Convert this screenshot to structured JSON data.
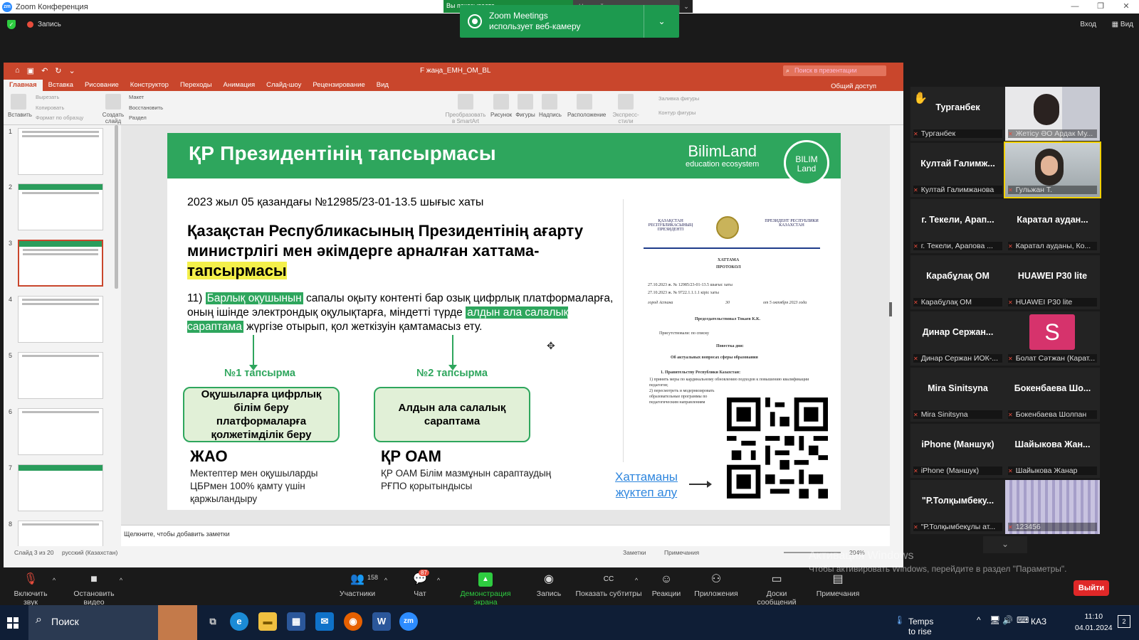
{
  "window": {
    "title": "Zoom Конференция",
    "controls": [
      "—",
      "❐",
      "✕"
    ]
  },
  "share_indicator": {
    "left": "Вы показываете",
    "right": "Настройки совместного",
    "dropdown": "⌄"
  },
  "notification": {
    "line1": "Zoom Meetings",
    "line2": "использует веб-камеру",
    "chevron": "⌄"
  },
  "topbar": {
    "record": "Запись",
    "login": "Вход",
    "view": "Вид"
  },
  "ppt": {
    "filename": "F жаңа_ЕМН_ОМ_BL",
    "search_placeholder": "Поиск в презентации",
    "tabs": [
      "Главная",
      "Вставка",
      "Рисование",
      "Конструктор",
      "Переходы",
      "Анимация",
      "Слайд-шоу",
      "Рецензирование",
      "Вид"
    ],
    "share": "Общий доступ",
    "ribbon": {
      "paste": "Вставить",
      "cut": "Вырезать",
      "copy": "Копировать",
      "format": "Формат по образцу",
      "new_slide": "Создать слайд",
      "layout": "Макет",
      "reset": "Восстановить",
      "section": "Раздел",
      "smartart": "Преобразовать в SmartArt",
      "picture": "Рисунок",
      "shapes": "Фигуры",
      "textbox": "Надпись",
      "arrange": "Расположение",
      "quickstyles": "Экспресс-стили",
      "fill": "Заливка фигуры",
      "outline": "Контур фигуры"
    },
    "thumb_numbers": [
      "1",
      "2",
      "3",
      "4",
      "5",
      "6",
      "7",
      "8"
    ],
    "notes_placeholder": "Щелкните, чтобы добавить заметки",
    "status": {
      "slide": "Слайд 3 из 20",
      "lang": "русский (Казахстан)",
      "notes": "Заметки",
      "comments": "Примечания",
      "zoom": "204%"
    }
  },
  "slide": {
    "title": "ҚР Президентінің тапсырмасы",
    "brand": "BilimLand",
    "brand_sub": "education ecosystem",
    "brand_logo": "BILIM Land",
    "letter": "2023 жыл 05 қазандағы  №12985/23-01-13.5 шығыс хаты",
    "heading_a": "Қазақстан Республикасының Президентінің ағарту министрлігі мен әкімдерге арналған хаттама-",
    "heading_b": "тапсырмасы",
    "body_1": "11) ",
    "body_hl1": "Барлық оқушынын",
    "body_2": " сапалы оқыту контенті бар озық цифрлық платформаларға, оның ішінде электрондық оқулықтарға, міндетті түрде ",
    "body_hl2": "алдын ала салалық сараптама",
    "body_3": " жүргізе отырып, қол жеткізуін қамтамасыз ету.",
    "task1": "№1 тапсырма",
    "task2": "№2 тапсырма",
    "box1": "Оқушыларға цифрлық білім беру платформаларға қолжетімділік беру",
    "box2": "Алдын ала салалық сараптама",
    "org1": "ЖАО",
    "org1_desc": "Мектептер мен оқушыларды ЦБРмен 100% қамту үшін қаржыландыру",
    "org2": "ҚР ОАМ",
    "org2_desc": "ҚР ОАМ Білім мазмұнын сараптаудың РҒПО қорытындысы",
    "link": "Хаттаманы жүктеп алу",
    "doc": {
      "hdr_left": "ҚАЗАҚСТАН РЕСПУБЛИКАСЫНЫҢ ПРЕЗИДЕНТІ",
      "hdr_right": "ПРЕЗИДЕНТ РЕСПУБЛИКИ КАЗАХСТАН",
      "title1": "ХАТТАМА",
      "title2": "ПРОТОКОЛ",
      "l1": "27.10.2023 ж. № 12985/23-01-13.5 шығыс хаты",
      "l2": "27.10.2023 ж. № 9722.1.1.1.1 кіріс хаты",
      "city": "город Астана",
      "num": "30",
      "date": "от 5 октября 2023 года",
      "chair": "Председательствовал Токаев К.К.",
      "present": "Присутствовали: по списку",
      "agenda": "Повестка дня:",
      "topic": "Об актуальных вопросах сферы образования",
      "item1": "1. Правительству Республики Казахстан:",
      "item2": "1) принять меры по кардинальному обновлению подходов к повышению квалификации педагогов;",
      "item3": "2) пересмотреть и модернизировать образовательные программы по педагогическим направлениям"
    }
  },
  "gallery": [
    {
      "name": "Турганбек",
      "label": "Турганбек",
      "type": "name"
    },
    {
      "name": "",
      "label": "Жетісу ӘО Ардак Му...",
      "type": "video"
    },
    {
      "name": "Култай Галимж...",
      "label": "Култай Галимжанова",
      "type": "name"
    },
    {
      "name": "",
      "label": "Гульжан Т.",
      "type": "video_speaker"
    },
    {
      "name": "г. Текели, Арап...",
      "label": "г. Текели, Арапова ...",
      "type": "name"
    },
    {
      "name": "Каратал аудан...",
      "label": "Каратал ауданы, Ко...",
      "type": "name"
    },
    {
      "name": "Карабұлақ ОМ",
      "label": "Карабұлақ ОМ",
      "type": "name"
    },
    {
      "name": "HUAWEI P30 lite",
      "label": "HUAWEI P30 lite",
      "type": "name"
    },
    {
      "name": "Динар Сержан...",
      "label": "Динар Сержан ИОК-...",
      "type": "name"
    },
    {
      "name": "S",
      "label": "Болат Сәтжан (Карат...",
      "type": "avatar"
    },
    {
      "name": "Mira Sinitsyna",
      "label": "Mira Sinitsyna",
      "type": "name"
    },
    {
      "name": "Бокенбаева Шо...",
      "label": "Бокенбаева Шолпан",
      "type": "name"
    },
    {
      "name": "iPhone (Маншук)",
      "label": "iPhone (Маншук)",
      "type": "name"
    },
    {
      "name": "Шайыкова Жан...",
      "label": "Шайыкова Жанар",
      "type": "name"
    },
    {
      "name": "\"Р.Толқымбеку...",
      "label": "\"Р.Толқымбекұлы ат...",
      "type": "name"
    },
    {
      "name": "",
      "label": "123456",
      "type": "video_blinds"
    }
  ],
  "win_activation": {
    "title": "Активация Windows",
    "text": "Чтобы активировать Windows, перейдите в раздел \"Параметры\"."
  },
  "toolbar": {
    "unmute": "Включить звук",
    "stop_video": "Остановить видео",
    "participants": "Участники",
    "participants_count": "158",
    "chat": "Чат",
    "chat_badge": "87",
    "share": "Демонстрация экрана",
    "record": "Запись",
    "captions": "Показать субтитры",
    "reactions": "Реакции",
    "apps": "Приложения",
    "whiteboards": "Доски сообщений",
    "notes": "Примечания",
    "leave": "Выйти"
  },
  "taskbar": {
    "search": "Поиск",
    "weather": "Temps to rise",
    "lang": "КАЗ",
    "time": "11:10",
    "date": "04.01.2024",
    "notif_count": "2"
  }
}
